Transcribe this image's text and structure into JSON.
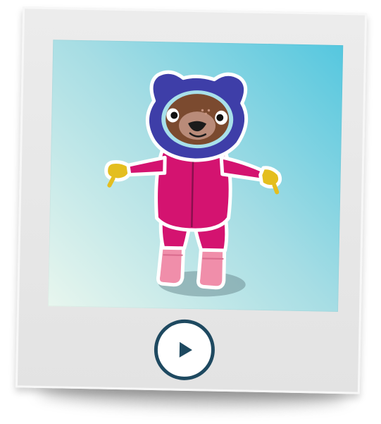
{
  "player": {
    "play_icon": "play-icon",
    "play_button_color": "#1e4960"
  },
  "colors": {
    "frame": "#ececec",
    "photo_top_right": "#55c7df",
    "photo_bottom_left": "#e8f6ee",
    "bear_hood": "#3d3fa6",
    "bear_suit": "#d4136f",
    "boots": "#ef8aa6",
    "mittens": "#e4be1f"
  }
}
